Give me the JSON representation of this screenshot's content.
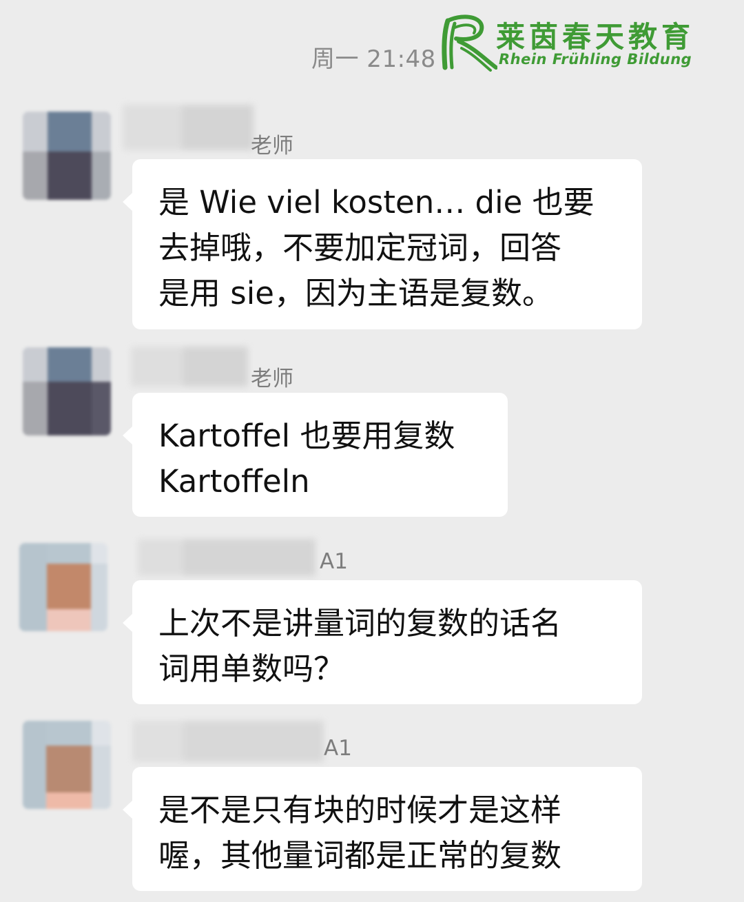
{
  "timestamp": "周一 21:48",
  "watermark": {
    "chinese": "莱茵春天教育",
    "english": "Rhein Frühling Bildung",
    "color": "#3f9b35"
  },
  "messages": [
    {
      "sender_visible": "老师",
      "lines": [
        "是 Wie viel kosten… die 也要",
        "去掉哦，不要加定冠词，回答",
        "是用 sie，因为主语是复数。"
      ]
    },
    {
      "sender_visible": "老师",
      "lines": [
        "Kartoffel 也要用复数",
        "Kartoffeln"
      ]
    },
    {
      "sender_visible": "A1",
      "lines": [
        "上次不是讲量词的复数的话名",
        "词用单数吗？"
      ]
    },
    {
      "sender_visible": "A1",
      "lines": [
        "是不是只有块的时候才是这样",
        "喔，其他量词都是正常的复数"
      ]
    }
  ],
  "colors": {
    "background": "#ececec",
    "bubble": "#ffffff",
    "text": "#111111",
    "meta_text": "#8a8a8a"
  }
}
